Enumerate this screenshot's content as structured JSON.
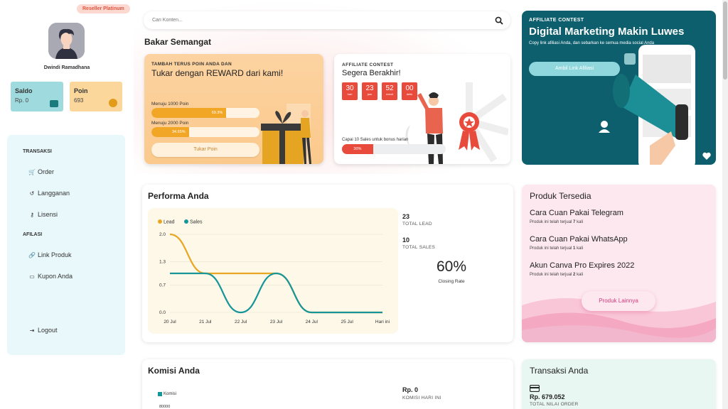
{
  "sidebar": {
    "badge": "Reseller Platinum",
    "username": "Dwindi Ramadhana",
    "saldo": {
      "label": "Saldo",
      "value": "Rp. 0"
    },
    "poin": {
      "label": "Poin",
      "value": "693"
    },
    "sections": [
      {
        "title": "TRANSAKSI",
        "items": [
          {
            "icon": "cart-icon",
            "label": "Order"
          },
          {
            "icon": "history-icon",
            "label": "Langganan"
          },
          {
            "icon": "key-icon",
            "label": "Lisensi"
          }
        ]
      },
      {
        "title": "AFILASI",
        "items": [
          {
            "icon": "link-icon",
            "label": "Link Produk"
          },
          {
            "icon": "ticket-icon",
            "label": "Kupon Anda"
          }
        ]
      }
    ],
    "logout": "Logout"
  },
  "search": {
    "placeholder": "Cari Konten..."
  },
  "main_title": "Bakar Semangat",
  "reward_card": {
    "small": "TAMBAH TERUS POIN ANDA DAN",
    "big": "Tukar dengan REWARD dari kami!",
    "progress": [
      {
        "label": "Menuju 1000 Poin",
        "value": 69.3,
        "text": "69.3%"
      },
      {
        "label": "Menuju 2000 Poin",
        "value": 34.65,
        "text": "34.65%"
      }
    ],
    "button": "Tukar Poin"
  },
  "contest_card": {
    "small": "AFFILIATE CONTEST",
    "big": "Segera Berakhir!",
    "countdown": [
      {
        "n": "30",
        "u": "hari"
      },
      {
        "n": "23",
        "u": "jam"
      },
      {
        "n": "52",
        "u": "menit"
      },
      {
        "n": "00",
        "u": "detik"
      }
    ],
    "note": "Capai 10 Sales untuk bonus harian",
    "progress_value": 30,
    "progress_text": "30%"
  },
  "affiliate_card": {
    "small": "AFFILIATE CONTEST",
    "big": "Digital Marketing Makin Luwes",
    "desc": "Copy link afiliasi Anda, dan sebarkan ke semua media social Anda",
    "button": "Ambil Link Afiliasi"
  },
  "performa": {
    "title": "Performa Anda",
    "total_lead": {
      "value": "23",
      "label": "TOTAL LEAD"
    },
    "total_sales": {
      "value": "10",
      "label": "TOTAL SALES"
    },
    "closing_rate": {
      "value": "60%",
      "label": "Closing Rate"
    }
  },
  "chart_data": {
    "type": "line",
    "categories": [
      "20 Jul",
      "21 Jul",
      "22 Jul",
      "23 Jul",
      "24 Jul",
      "25 Jul",
      "Hari ini"
    ],
    "yticks": [
      "2.0",
      "1.3",
      "0.7",
      "0.0"
    ],
    "ylim": [
      0,
      2
    ],
    "legend_position": "top-left",
    "series": [
      {
        "name": "Lead",
        "color": "#e9a623",
        "values": [
          2,
          1,
          1,
          1,
          0,
          0,
          0
        ]
      },
      {
        "name": "Sales",
        "color": "#17969a",
        "values": [
          1,
          1,
          0,
          1,
          0,
          0,
          0
        ]
      }
    ]
  },
  "produk": {
    "title": "Produk Tersedia",
    "items": [
      {
        "name": "Cara Cuan Pakai Telegram",
        "sold_prefix": "Produk ini telah terjual",
        "sold": "7",
        "sold_suffix": "kali"
      },
      {
        "name": "Cara Cuan Pakai WhatsApp",
        "sold_prefix": "Produk ini telah terjual",
        "sold": "1",
        "sold_suffix": "kali"
      },
      {
        "name": "Akun Canva Pro Expires 2022",
        "sold_prefix": "Produk ini telah terjual",
        "sold": "2",
        "sold_suffix": "kali"
      }
    ],
    "button": "Produk Lainnya"
  },
  "komisi": {
    "title": "Komisi Anda",
    "legend": "Komisi",
    "ytick": "80000",
    "today_value": "Rp. 0",
    "today_label": "KOMISI HARI INI"
  },
  "transaksi": {
    "title": "Transaksi Anda",
    "value": "Rp. 679.052",
    "label": "TOTAL NILAI ORDER"
  },
  "colors": {
    "accent_orange": "#f2a626",
    "accent_red": "#e84a3c",
    "teal": "#0e5f6e",
    "pink": "#d63a7a"
  }
}
